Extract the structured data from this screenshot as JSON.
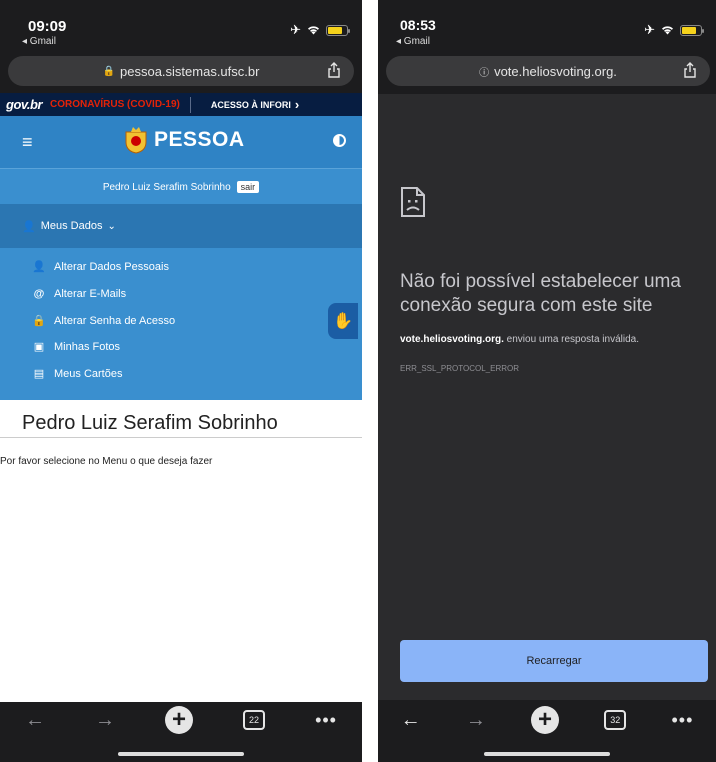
{
  "left": {
    "status": {
      "time": "09:09",
      "back_label": "◂ Gmail"
    },
    "url": "pessoa.sistemas.ufsc.br",
    "govbar": {
      "logo": "gov.br",
      "covid": "CORONAVÍRUS (COVID-19)",
      "acesso": "ACESSO À INFORI"
    },
    "header": {
      "title": "PESSOA"
    },
    "user": {
      "name": "Pedro Luiz Serafim Sobrinho",
      "logout": "sair"
    },
    "menu_section": "Meus Dados",
    "menu_items": [
      {
        "label": "Alterar Dados Pessoais",
        "icon": "user-edit-icon"
      },
      {
        "label": "Alterar E-Mails",
        "icon": "at-icon"
      },
      {
        "label": "Alterar Senha de Acesso",
        "icon": "lock-icon"
      },
      {
        "label": "Minhas Fotos",
        "icon": "camera-icon"
      },
      {
        "label": "Meus Cartões",
        "icon": "card-icon"
      }
    ],
    "content": {
      "title": "Pedro Luiz Serafim Sobrinho",
      "message": "Por favor selecione no Menu o que deseja fazer"
    },
    "toolbar": {
      "tab_count": "22"
    }
  },
  "right": {
    "status": {
      "time": "08:53",
      "back_label": "◂ Gmail"
    },
    "url": "vote.heliosvoting.org.",
    "error": {
      "title": "Não foi possível estabelecer uma conexão segura com este site",
      "host": "vote.heliosvoting.org.",
      "description": " enviou uma resposta inválida.",
      "code": "ERR_SSL_PROTOCOL_ERROR",
      "reload": "Recarregar"
    },
    "toolbar": {
      "tab_count": "32"
    }
  },
  "colors": {
    "header_blue": "#2f83c5",
    "gov_navy": "#071d41",
    "covid_red": "#e52207",
    "reload_blue": "#8ab4f8"
  }
}
